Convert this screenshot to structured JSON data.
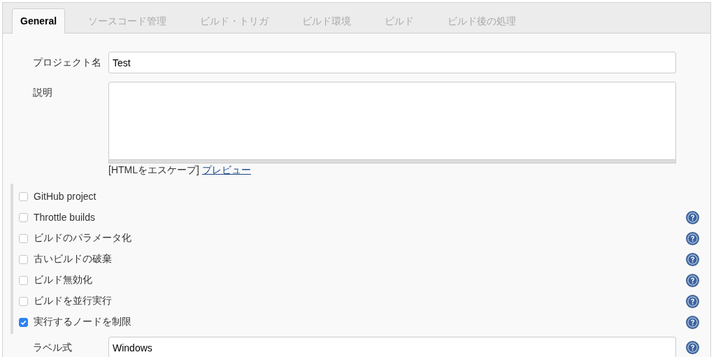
{
  "tabs": [
    {
      "label": "General",
      "selected": true
    },
    {
      "label": "ソースコード管理",
      "selected": false
    },
    {
      "label": "ビルド・トリガ",
      "selected": false
    },
    {
      "label": "ビルド環境",
      "selected": false
    },
    {
      "label": "ビルド",
      "selected": false
    },
    {
      "label": "ビルド後の処理",
      "selected": false
    }
  ],
  "project_name": {
    "label": "プロジェクト名",
    "value": "Test"
  },
  "description": {
    "label": "説明",
    "escape_note": "[HTMLをエスケープ]",
    "preview_link": "プレビュー"
  },
  "options": [
    {
      "label": "GitHub project",
      "checked": false,
      "help": false
    },
    {
      "label": "Throttle builds",
      "checked": false,
      "help": true
    },
    {
      "label": "ビルドのパラメータ化",
      "checked": false,
      "help": true
    },
    {
      "label": "古いビルドの破棄",
      "checked": false,
      "help": true
    },
    {
      "label": "ビルド無効化",
      "checked": false,
      "help": true
    },
    {
      "label": "ビルドを並行実行",
      "checked": false,
      "help": true
    },
    {
      "label": "実行するノードを制限",
      "checked": true,
      "help": true
    }
  ],
  "label_expression": {
    "label": "ラベル式",
    "value": "Windows",
    "help": true
  }
}
